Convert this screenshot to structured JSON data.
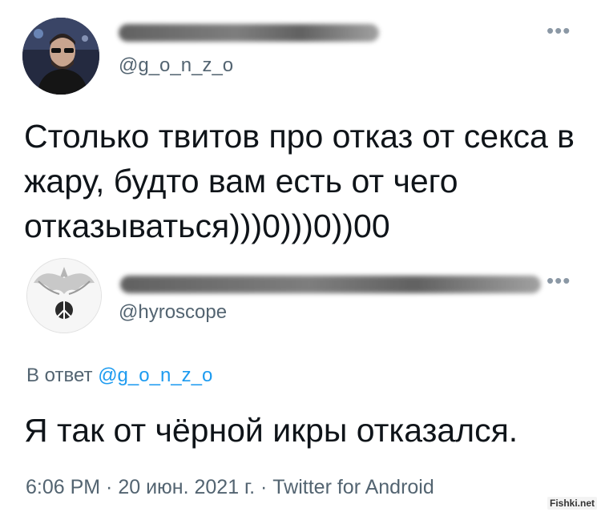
{
  "tweet_1": {
    "avatar": "user-avatar-man-sunglasses",
    "handle": "@g_o_n_z_o",
    "more_icon": "more-dots-icon",
    "text": "Столько твитов про отказ от секса в жару, будто вам есть от чего отказываться)))0)))0))00"
  },
  "tweet_2": {
    "avatar": "user-avatar-eagle-emblem",
    "handle": "@hyroscope",
    "more_icon": "more-dots-icon",
    "reply_prefix": "В ответ",
    "reply_handle": "@g_o_n_z_o",
    "text": "Я так от чёрной икры отказался.",
    "meta": "6:06 PM · 20 июн. 2021 г. · Twitter for Android"
  },
  "watermark": "Fishki.net",
  "colors": {
    "text": "#0f1419",
    "secondary": "#536471",
    "link": "#1d9bf0"
  }
}
